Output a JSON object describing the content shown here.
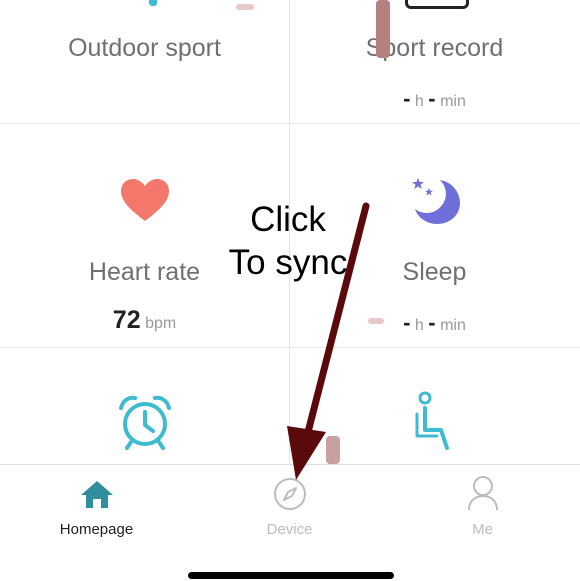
{
  "tiles": {
    "outdoor_sport": {
      "label": "Outdoor sport"
    },
    "sport_record": {
      "label": "Sport record",
      "hours": "-",
      "hours_unit": "h",
      "minutes": "-",
      "minutes_unit": "min"
    },
    "heart_rate": {
      "label": "Heart rate",
      "value": "72",
      "unit": "bpm"
    },
    "sleep": {
      "label": "Sleep",
      "hours": "-",
      "hours_unit": "h",
      "minutes": "-",
      "minutes_unit": "min"
    },
    "alarm": {
      "icon": "alarm-clock-icon"
    },
    "sedentary": {
      "icon": "sedentary-person-icon"
    }
  },
  "tabbar": {
    "homepage": {
      "label": "Homepage",
      "icon": "home-icon"
    },
    "device": {
      "label": "Device",
      "icon": "compass-icon"
    },
    "me": {
      "label": "Me",
      "icon": "person-icon"
    }
  },
  "annotation": {
    "line1": "Click",
    "line2": "To sync"
  },
  "colors": {
    "heart": "#f4776b",
    "moon": "#6e6fd9",
    "teal_icon": "#3dbbd0",
    "tab_active": "#222222",
    "tab_inactive": "#bdbdbd",
    "home_icon": "#2f8f9d",
    "arrow": "#5a0a0a"
  }
}
